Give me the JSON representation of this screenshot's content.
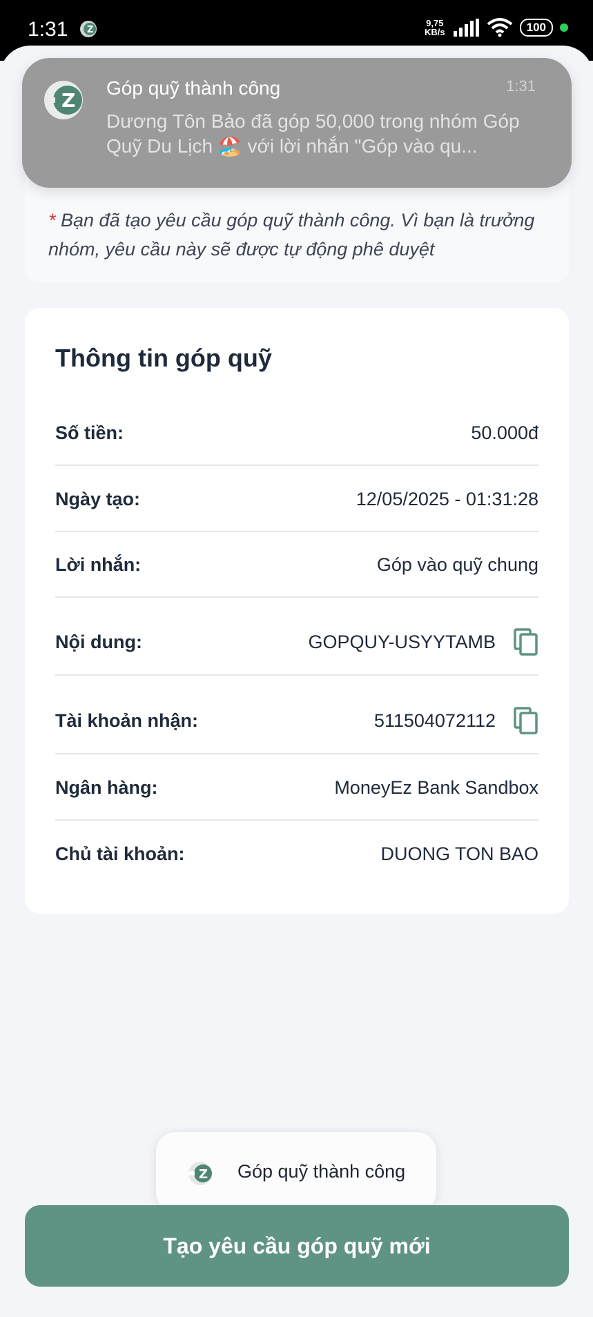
{
  "status_bar": {
    "time": "1:31",
    "net_speed_value": "9,75",
    "net_speed_unit": "KB/s",
    "battery": "100"
  },
  "notification": {
    "title": "Góp quỹ thành công",
    "time": "1:31",
    "body": "Dương Tôn Bảo đã góp 50,000 trong nhóm Góp Quỹ Du Lịch 🏖️ với lời nhắn \"Góp vào qu..."
  },
  "notice": {
    "star": "*",
    "text": " Bạn đã tạo yêu cầu góp quỹ thành công. Vì bạn là trưởng nhóm, yêu cầu này sẽ được tự động phê duyệt"
  },
  "info": {
    "title": "Thông tin góp quỹ",
    "rows": [
      {
        "label": "Số tiền:",
        "value": "50.000đ"
      },
      {
        "label": "Ngày tạo:",
        "value": "12/05/2025 - 01:31:28"
      },
      {
        "label": "Lời nhắn:",
        "value": "Góp vào quỹ chung"
      },
      {
        "label": "Nội dung:",
        "value": "GOPQUY-USYYTAMB",
        "icon": "copy-icon"
      },
      {
        "label": "Tài khoản nhận:",
        "value": "511504072112",
        "icon": "copy-icon"
      },
      {
        "label": "Ngân hàng:",
        "value": "MoneyEz Bank Sandbox"
      },
      {
        "label": "Chủ tài khoản:",
        "value": "DUONG TON BAO"
      }
    ]
  },
  "toast": {
    "text": "Góp quỹ thành công"
  },
  "actions": {
    "new_request_label": "Tạo yêu cầu góp quỹ mới"
  },
  "colors": {
    "primary": "#5f9384",
    "notification_bg": "#9a9a9a",
    "status_dot": "#2ed158"
  }
}
